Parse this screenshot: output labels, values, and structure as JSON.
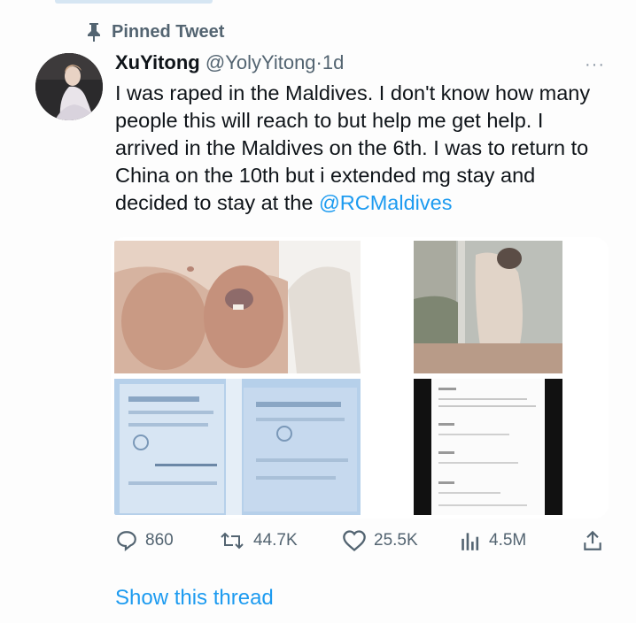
{
  "pinned_label": "Pinned Tweet",
  "tweet": {
    "author_name": "XuYitong",
    "handle": "@YolyYitong",
    "separator": "·",
    "time": "1d",
    "more_label": "···",
    "text_main": "I was raped in the Maldives. I don't know how many people this will reach to but help me get help. I arrived in the Maldives on the 6th. I was to return to China on the 10th but i extended mg stay and decided to stay at the",
    "mention": "@RCMaldives",
    "media_count": 4
  },
  "actions": {
    "replies": "860",
    "retweets": "44.7K",
    "likes": "25.5K",
    "views": "4.5M"
  },
  "show_thread": "Show this thread",
  "colors": {
    "accent": "#1d9bf0",
    "secondary_text": "#536471",
    "primary_text": "#0f1419"
  }
}
